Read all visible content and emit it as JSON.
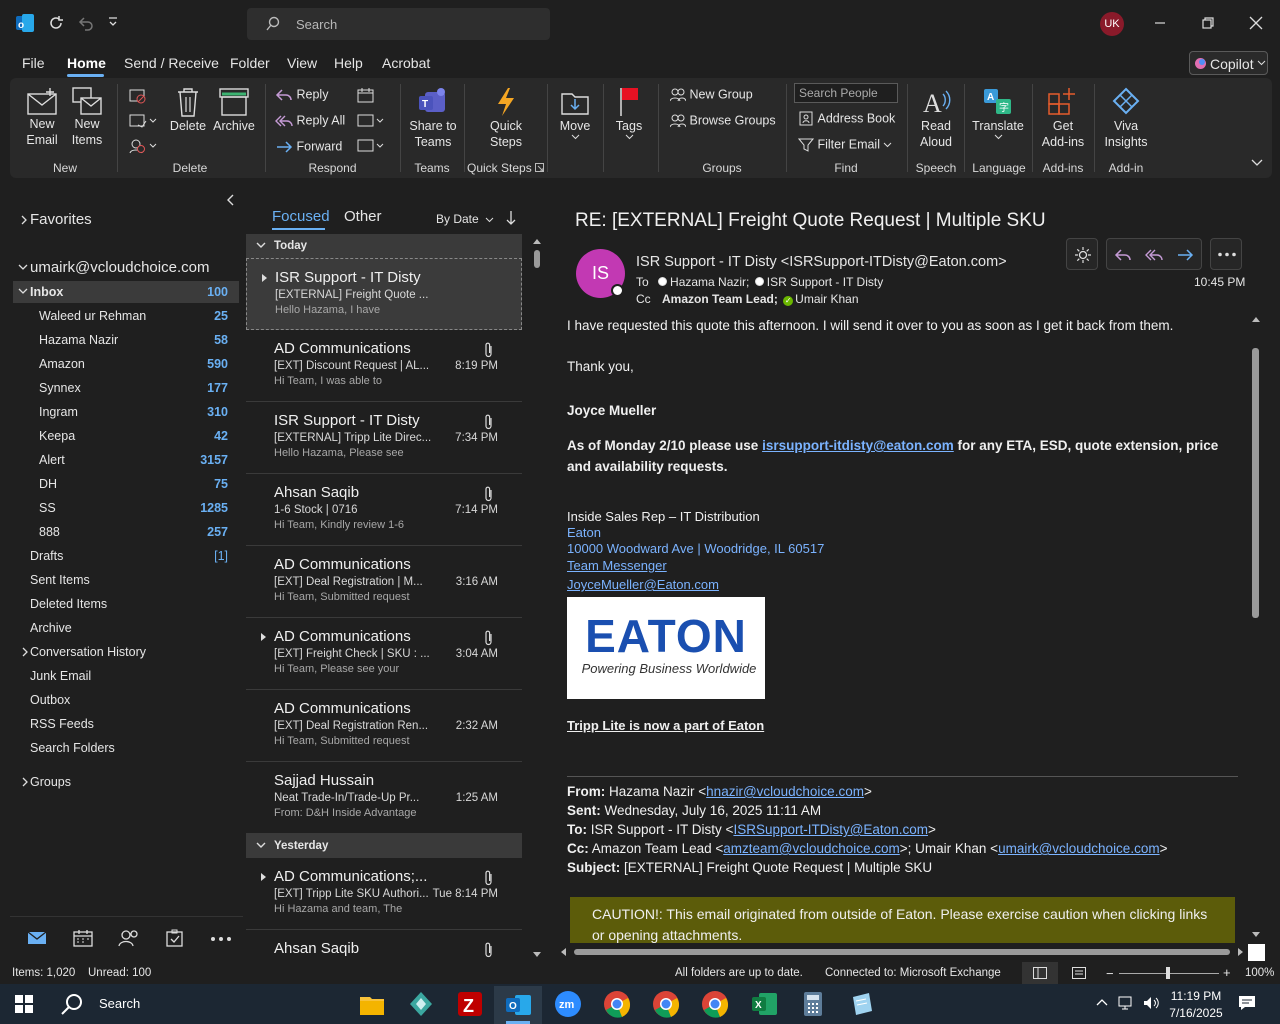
{
  "titlebar": {
    "search_placeholder": "Search",
    "user_initials": "UK"
  },
  "menu": {
    "tabs": [
      "File",
      "Home",
      "Send / Receive",
      "Folder",
      "View",
      "Help",
      "Acrobat"
    ],
    "active": "Home",
    "copilot_label": "Copilot"
  },
  "ribbon": {
    "new_email": [
      "New",
      "Email"
    ],
    "new_items": [
      "New",
      "Items"
    ],
    "delete": "Delete",
    "archive": "Archive",
    "reply": "Reply",
    "reply_all": "Reply All",
    "forward": "Forward",
    "share_teams": [
      "Share to",
      "Teams"
    ],
    "quick_steps": [
      "Quick",
      "Steps"
    ],
    "move": "Move",
    "tags": "Tags",
    "new_group": "New Group",
    "browse_groups": "Browse Groups",
    "search_people": "Search People",
    "address_book": "Address Book",
    "filter_email": "Filter Email",
    "read_aloud": [
      "Read",
      "Aloud"
    ],
    "translate": "Translate",
    "get_addins": [
      "Get",
      "Add-ins"
    ],
    "viva": [
      "Viva",
      "Insights"
    ],
    "groups": [
      "New",
      "Delete",
      "Respond",
      "Teams",
      "Quick Steps",
      "Groups",
      "Find",
      "Speech",
      "Language",
      "Add-ins",
      "Add-in"
    ]
  },
  "folders": {
    "favorites": "Favorites",
    "account": "umairk@vcloudchoice.com",
    "inbox": {
      "label": "Inbox",
      "count": "100"
    },
    "subfolders": [
      {
        "label": "Waleed ur Rehman",
        "count": "25"
      },
      {
        "label": "Hazama Nazir",
        "count": "58"
      },
      {
        "label": "Amazon",
        "count": "590"
      },
      {
        "label": "Synnex",
        "count": "177"
      },
      {
        "label": "Ingram",
        "count": "310"
      },
      {
        "label": "Keepa",
        "count": "42"
      },
      {
        "label": "Alert",
        "count": "3157"
      },
      {
        "label": "DH",
        "count": "75"
      },
      {
        "label": "SS",
        "count": "1285"
      },
      {
        "label": "888",
        "count": "257"
      }
    ],
    "drafts": {
      "label": "Drafts",
      "count": "[1]"
    },
    "others": [
      "Sent Items",
      "Deleted Items",
      "Archive",
      "Conversation History",
      "Junk Email",
      "Outbox",
      "RSS Feeds",
      "Search Folders"
    ],
    "groups": "Groups"
  },
  "list": {
    "focused": "Focused",
    "other": "Other",
    "sort": "By Date",
    "today": "Today",
    "yesterday": "Yesterday",
    "today_items": [
      {
        "sender": "ISR Support - IT Disty",
        "subject": "[EXTERNAL] Freight Quote ...",
        "preview": "Hello Hazama,  I have",
        "time": "",
        "clip": false
      },
      {
        "sender": "AD Communications",
        "subject": "[EXT] Discount Request | AL...",
        "preview": "Hi Team,  I was able to",
        "time": "8:19 PM",
        "clip": true
      },
      {
        "sender": "ISR Support - IT Disty",
        "subject": "[EXTERNAL] Tripp Lite Direc...",
        "preview": "Hello Hazama,  Please see",
        "time": "7:34 PM",
        "clip": true
      },
      {
        "sender": "Ahsan Saqib",
        "subject": "1-6 Stock | 0716",
        "preview": "Hi Team,  Kindly review 1-6",
        "time": "7:14 PM",
        "clip": true
      },
      {
        "sender": "AD Communications",
        "subject": "[EXT] Deal Registration | M...",
        "preview": "Hi Team,   Submitted request",
        "time": "3:16 AM",
        "clip": false
      },
      {
        "sender": "AD Communications",
        "subject": "[EXT] Freight Check | SKU : ...",
        "preview": "Hi Team,   Please see your",
        "time": "3:04 AM",
        "clip": true
      },
      {
        "sender": "AD Communications",
        "subject": "[EXT] Deal Registration Ren...",
        "preview": "Hi Team,   Submitted request",
        "time": "2:32 AM",
        "clip": false
      },
      {
        "sender": "Sajjad Hussain",
        "subject": "Neat Trade-In/Trade-Up Pr...",
        "preview": "From: D&H Inside Advantage",
        "time": "1:25 AM",
        "clip": false
      }
    ],
    "yesterday_items": [
      {
        "sender": "AD Communications;...",
        "subject": "[EXT] Tripp Lite SKU Authori...",
        "preview": "Hi Hazama and team,  The",
        "time": "Tue 8:14 PM",
        "clip": true
      },
      {
        "sender": "Ahsan Saqib",
        "subject": "",
        "preview": "",
        "time": "",
        "clip": true
      }
    ]
  },
  "reading": {
    "subject": "RE: [EXTERNAL] Freight Quote Request | Multiple SKU",
    "avatar": "IS",
    "from": "ISR Support - IT Disty <ISRSupport-ITDisty@Eaton.com>",
    "to_label": "To",
    "to1": "Hazama Nazir;",
    "to2": "ISR Support - IT Disty",
    "cc_label": "Cc",
    "cc1": "Amazon Team Lead;",
    "cc2": "Umair Khan",
    "time": "10:45 PM",
    "body1": "I have requested this quote this afternoon.  I will send it over to you as soon as I get it back from them.",
    "thanks": "Thank you,",
    "sig_name": "Joyce Mueller",
    "notice_a": "As of Monday 2/10 please use ",
    "notice_link": "isrsupport-itdisty@eaton.com",
    "notice_b": " for any ETA, ESD, quote extension, price",
    "notice_c": "and availability requests.",
    "role": "Inside Sales Rep – IT Distribution",
    "company": "Eaton",
    "address": "10000 Woodward Ave | Woodridge, IL 60517",
    "teams": "Team Messenger",
    "email": "JoyceMueller@Eaton.com",
    "logo_text": "EATON",
    "logo_tag": "Powering Business Worldwide",
    "tripp": "Tripp Lite is now a part of Eaton",
    "q_from_label": "From:",
    "q_from": " Hazama Nazir <",
    "q_from_link": "hnazir@vcloudchoice.com",
    "q_sent_label": "Sent:",
    "q_sent": " Wednesday, July 16, 2025 11:11 AM",
    "q_to_label": "To:",
    "q_to": " ISR Support - IT Disty <",
    "q_to_link": "ISRSupport-ITDisty@Eaton.com",
    "q_cc_label": "Cc:",
    "q_cc": " Amazon Team Lead <",
    "q_cc_link1": "amzteam@vcloudchoice.com",
    "q_cc_mid": ">; Umair Khan <",
    "q_cc_link2": "umairk@vcloudchoice.com",
    "q_subj_label": "Subject:",
    "q_subj": " [EXTERNAL] Freight Quote Request | Multiple SKU",
    "caution1": "CAUTION!: This email originated from outside of Eaton. Please exercise caution when clicking links",
    "caution2": "or opening attachments."
  },
  "status": {
    "items": "Items: 1,020",
    "unread": "Unread: 100",
    "sync": "All folders are up to date.",
    "connected": "Connected to: Microsoft Exchange",
    "zoom": "100%"
  },
  "taskbar": {
    "search": "Search",
    "time": "11:19 PM",
    "date": "7/16/2025"
  },
  "colors": {
    "accent": "#6ab0f3",
    "avatar_is": "#c239b3",
    "caution_bg": "#5c5c0a"
  }
}
